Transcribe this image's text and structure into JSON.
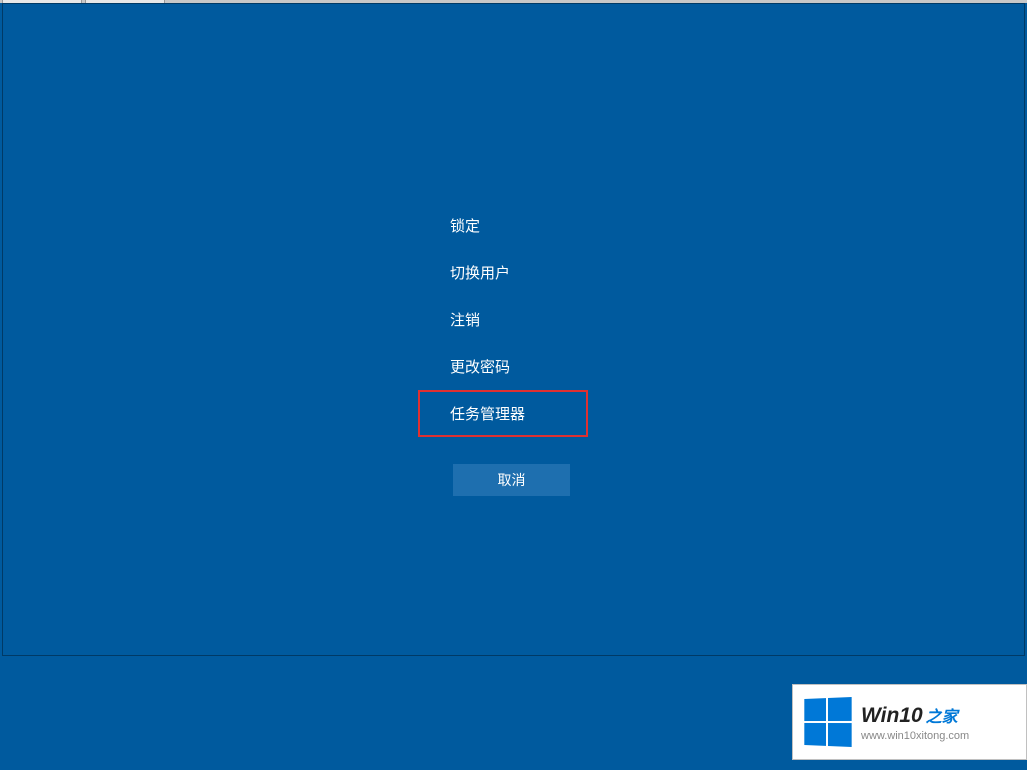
{
  "menu": {
    "items": [
      {
        "label": "锁定",
        "highlighted": false
      },
      {
        "label": "切换用户",
        "highlighted": false
      },
      {
        "label": "注销",
        "highlighted": false
      },
      {
        "label": "更改密码",
        "highlighted": false
      },
      {
        "label": "任务管理器",
        "highlighted": true
      }
    ]
  },
  "cancel": {
    "label": "取消"
  },
  "watermark": {
    "title_main": "Win10",
    "title_sub": "之家",
    "url": "www.win10xitong.com"
  }
}
